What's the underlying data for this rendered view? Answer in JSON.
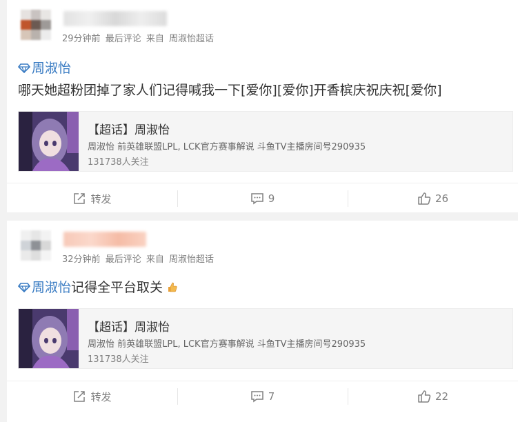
{
  "posts": [
    {
      "meta": {
        "time": "29分钟前",
        "last_comment": "最后评论",
        "source_prefix": "来自",
        "source": "周淑怡超话"
      },
      "topic": "周淑怡",
      "text": "哪天她超粉团掉了家人们记得喊我一下[爱你][爱你]开香槟庆祝庆祝[爱你]",
      "share": {
        "title": "【超话】周淑怡",
        "desc": "周淑怡 前英雄联盟LPL, LCK官方赛事解说 斗鱼TV主播房间号290935",
        "followers": "131738人关注"
      },
      "actions": {
        "repost": "转发",
        "comments": "9",
        "likes": "26"
      }
    },
    {
      "meta": {
        "time": "32分钟前",
        "last_comment": "最后评论",
        "source_prefix": "来自",
        "source": "周淑怡超话"
      },
      "topic": "周淑怡",
      "text": "记得全平台取关",
      "share": {
        "title": "【超话】周淑怡",
        "desc": "周淑怡 前英雄联盟LPL, LCK官方赛事解说 斗鱼TV主播房间号290935",
        "followers": "131738人关注"
      },
      "actions": {
        "repost": "转发",
        "comments": "7",
        "likes": "22"
      }
    }
  ],
  "colors": {
    "link": "#3a7cc3",
    "meta": "#808080",
    "text": "#333333"
  },
  "icons": [
    "gem-icon",
    "thumbs-up-emoji",
    "repost-icon",
    "comment-icon",
    "like-icon"
  ]
}
